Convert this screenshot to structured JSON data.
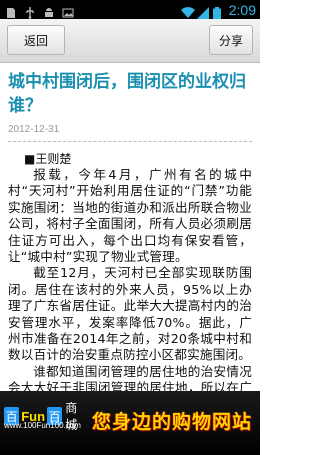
{
  "status_bar": {
    "time": "2:09",
    "icons": [
      "sd-card-icon",
      "usb-icon",
      "android-debug-icon",
      "picture-icon",
      "wifi-icon",
      "signal-icon",
      "battery-icon"
    ]
  },
  "toolbar": {
    "back_label": "返回",
    "share_label": "分享"
  },
  "article": {
    "title": "城中村围闭后，围闭区的业权归谁？",
    "date": "2012-12-31",
    "author": "■王则楚",
    "paragraphs": [
      "报载，今年4月，广州有名的城中村“天河村”开始利用居住证的“门禁”功能实施围闭：当地的街道办和派出所联合物业公司，将村子全面围闭，所有人员必须刷居住证方可出入，每个出口均有保安看管，让“城中村”实现了物业式管理。",
      "截至12月，天河村已全部实现联防围闭。居住在该村的外来人员，95%以上办理了广东省居住证。此举大大提高村内的治安管理水平，发案率降低70%。据此，广州市准备在2014年之前，对20条城中村和数以百计的治安重点防控小区都实施围闭。",
      "谁都知道围闭管理的居住地的治安情况会大大好于非围闭管理的居住地，所以在广州的许多“小区”，但凡是人"
    ]
  },
  "banner": {
    "logo_bai": "百",
    "logo_fun": "Fun",
    "logo_bai2": "百",
    "logo_mall": "商城",
    "logo_url": "www.100Fun100.com",
    "slogan": "您身边的购物网站",
    "colors": {
      "slogan": "#ffd400",
      "background": "#000000"
    }
  }
}
